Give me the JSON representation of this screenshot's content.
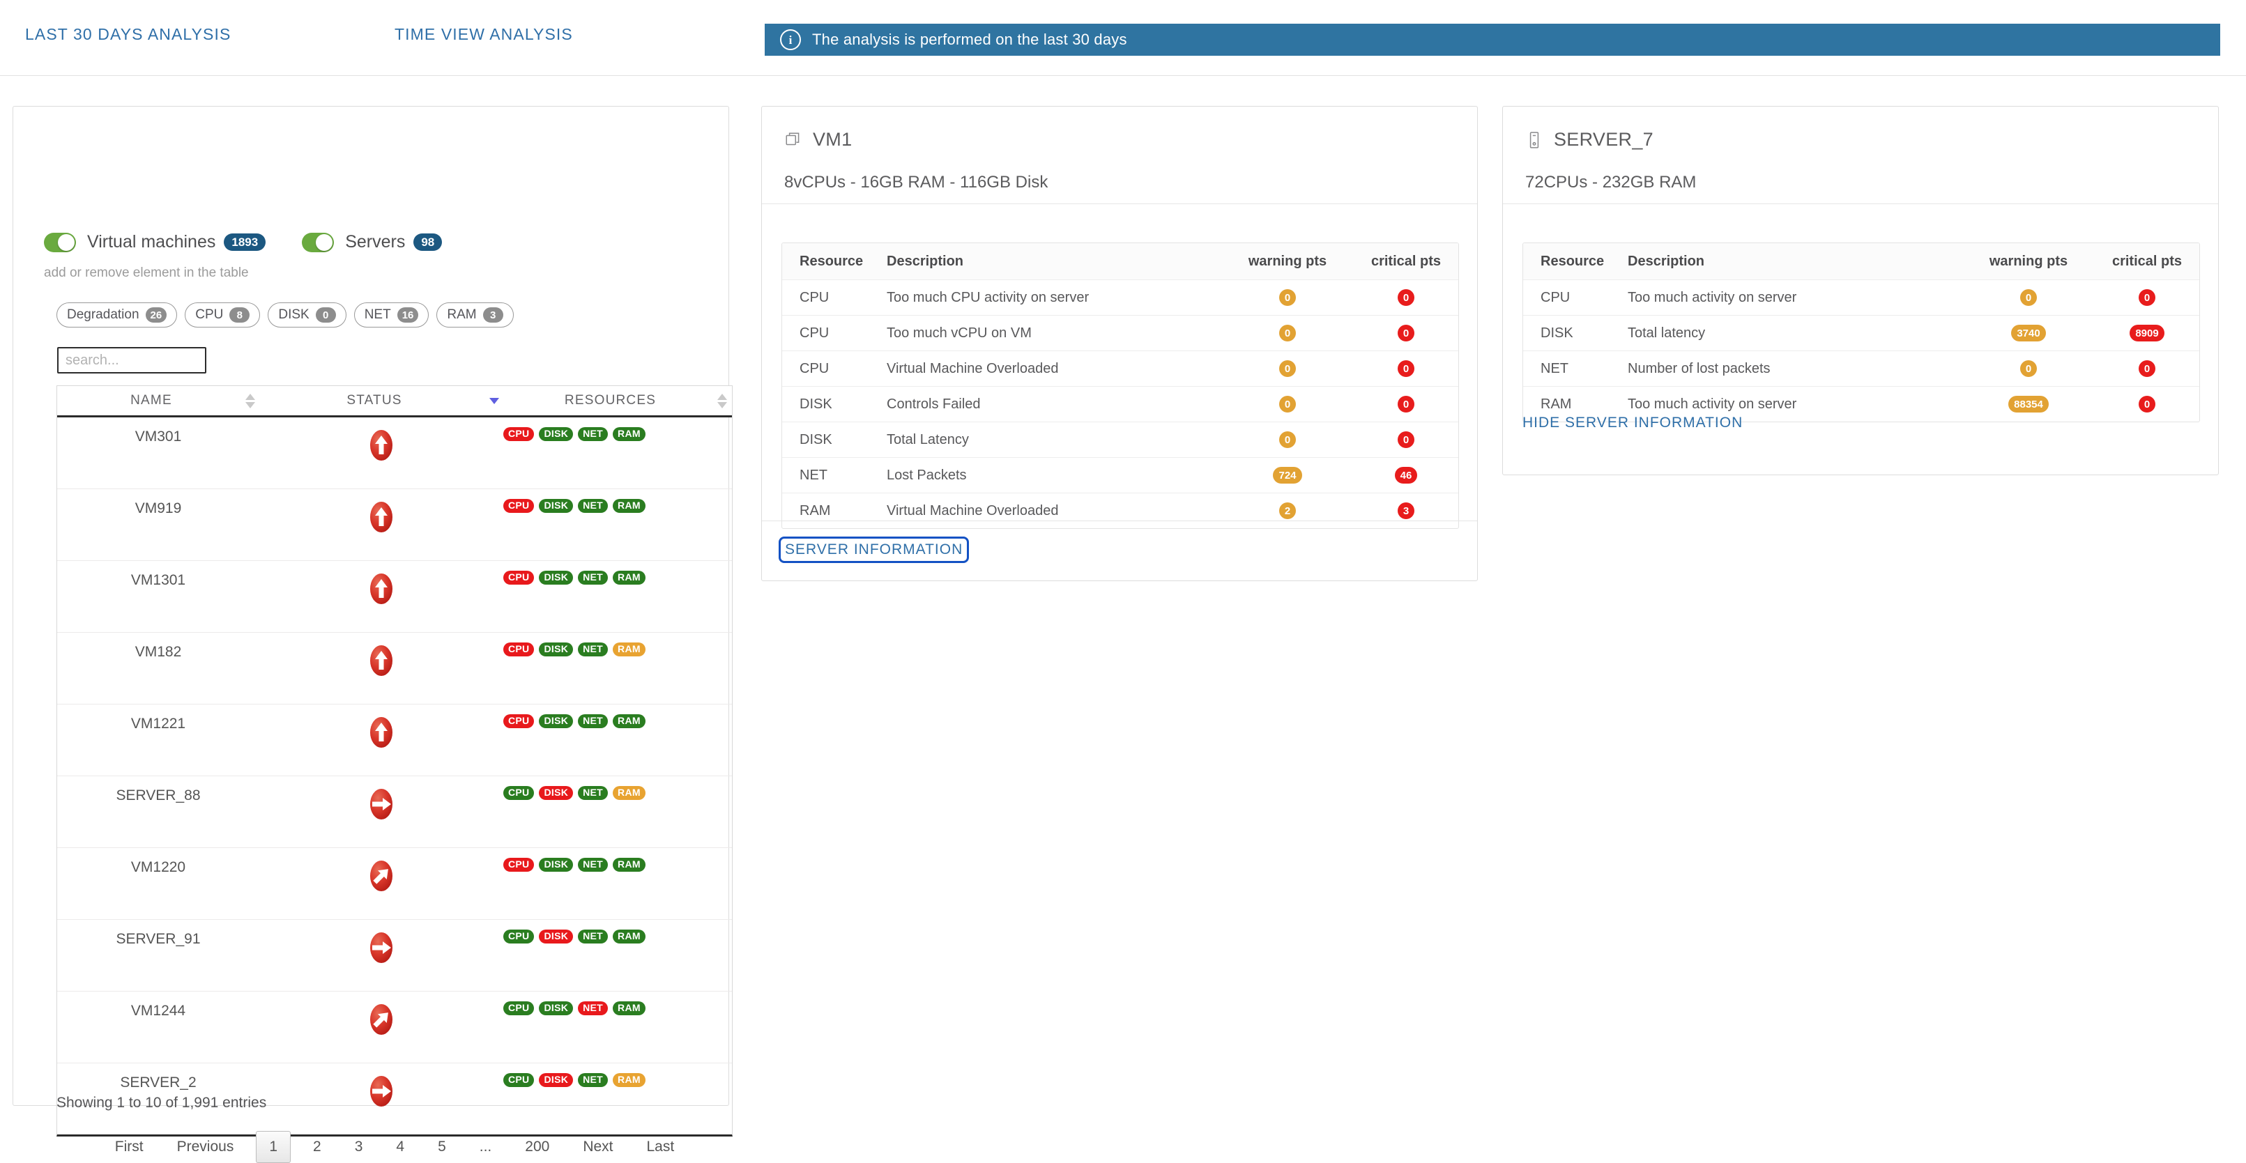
{
  "tabs": [
    {
      "label": "LAST 30 DAYS ANALYSIS"
    },
    {
      "label": "TIME VIEW ANALYSIS"
    }
  ],
  "alert": {
    "icon": "info-icon",
    "glyph": "i",
    "text": "The analysis is performed on the last 30 days",
    "color": "#2f74a1"
  },
  "filters": {
    "toggles": [
      {
        "label": "Virtual machines",
        "count": "1893",
        "on": true
      },
      {
        "label": "Servers",
        "count": "98",
        "on": true
      }
    ],
    "hint": "add or remove element in the table",
    "chips": [
      {
        "label": "Degradation",
        "count": "26"
      },
      {
        "label": "CPU",
        "count": "8"
      },
      {
        "label": "DISK",
        "count": "0"
      },
      {
        "label": "NET",
        "count": "16"
      },
      {
        "label": "RAM",
        "count": "3"
      }
    ],
    "search": {
      "value": "",
      "placeholder": "search..."
    }
  },
  "table": {
    "columns": [
      "NAME",
      "STATUS",
      "RESOURCES"
    ],
    "sorted_column": "STATUS",
    "sort_direction": "desc",
    "rows": [
      {
        "name": "VM301",
        "status": "up",
        "resources": [
          {
            "label": "CPU",
            "state": "red"
          },
          {
            "label": "DISK",
            "state": "green"
          },
          {
            "label": "NET",
            "state": "green"
          },
          {
            "label": "RAM",
            "state": "green"
          }
        ]
      },
      {
        "name": "VM919",
        "status": "up",
        "resources": [
          {
            "label": "CPU",
            "state": "red"
          },
          {
            "label": "DISK",
            "state": "green"
          },
          {
            "label": "NET",
            "state": "green"
          },
          {
            "label": "RAM",
            "state": "green"
          }
        ]
      },
      {
        "name": "VM1301",
        "status": "up",
        "resources": [
          {
            "label": "CPU",
            "state": "red"
          },
          {
            "label": "DISK",
            "state": "green"
          },
          {
            "label": "NET",
            "state": "green"
          },
          {
            "label": "RAM",
            "state": "green"
          }
        ]
      },
      {
        "name": "VM182",
        "status": "up",
        "resources": [
          {
            "label": "CPU",
            "state": "red"
          },
          {
            "label": "DISK",
            "state": "green"
          },
          {
            "label": "NET",
            "state": "green"
          },
          {
            "label": "RAM",
            "state": "orange"
          }
        ]
      },
      {
        "name": "VM1221",
        "status": "up",
        "resources": [
          {
            "label": "CPU",
            "state": "red"
          },
          {
            "label": "DISK",
            "state": "green"
          },
          {
            "label": "NET",
            "state": "green"
          },
          {
            "label": "RAM",
            "state": "green"
          }
        ]
      },
      {
        "name": "SERVER_88",
        "status": "right",
        "resources": [
          {
            "label": "CPU",
            "state": "green"
          },
          {
            "label": "DISK",
            "state": "red"
          },
          {
            "label": "NET",
            "state": "green"
          },
          {
            "label": "RAM",
            "state": "orange"
          }
        ]
      },
      {
        "name": "VM1220",
        "status": "up-right",
        "resources": [
          {
            "label": "CPU",
            "state": "red"
          },
          {
            "label": "DISK",
            "state": "green"
          },
          {
            "label": "NET",
            "state": "green"
          },
          {
            "label": "RAM",
            "state": "green"
          }
        ]
      },
      {
        "name": "SERVER_91",
        "status": "right",
        "resources": [
          {
            "label": "CPU",
            "state": "green"
          },
          {
            "label": "DISK",
            "state": "red"
          },
          {
            "label": "NET",
            "state": "green"
          },
          {
            "label": "RAM",
            "state": "green"
          }
        ]
      },
      {
        "name": "VM1244",
        "status": "up-right",
        "resources": [
          {
            "label": "CPU",
            "state": "green"
          },
          {
            "label": "DISK",
            "state": "green"
          },
          {
            "label": "NET",
            "state": "red"
          },
          {
            "label": "RAM",
            "state": "green"
          }
        ]
      },
      {
        "name": "SERVER_2",
        "status": "right",
        "resources": [
          {
            "label": "CPU",
            "state": "green"
          },
          {
            "label": "DISK",
            "state": "red"
          },
          {
            "label": "NET",
            "state": "green"
          },
          {
            "label": "RAM",
            "state": "orange"
          }
        ]
      }
    ],
    "showing": "Showing 1 to 10 of 1,991 entries",
    "pagination": {
      "first": "First",
      "previous": "Previous",
      "pages": [
        "1",
        "2",
        "3",
        "4",
        "5",
        "...",
        "200"
      ],
      "current": "1",
      "next": "Next",
      "last": "Last"
    }
  },
  "vm_detail": {
    "icon": "virtual-machine-icon",
    "title": "VM1",
    "spec": "8vCPUs - 16GB RAM - 116GB Disk",
    "columns": [
      "Resource",
      "Description",
      "warning pts",
      "critical pts"
    ],
    "rows": [
      {
        "resource": "CPU",
        "description": "Too much CPU activity on server",
        "warning": "0",
        "critical": "0"
      },
      {
        "resource": "CPU",
        "description": "Too much vCPU on VM",
        "warning": "0",
        "critical": "0"
      },
      {
        "resource": "CPU",
        "description": "Virtual Machine Overloaded",
        "warning": "0",
        "critical": "0"
      },
      {
        "resource": "DISK",
        "description": "Controls Failed",
        "warning": "0",
        "critical": "0"
      },
      {
        "resource": "DISK",
        "description": "Total Latency",
        "warning": "0",
        "critical": "0"
      },
      {
        "resource": "NET",
        "description": "Lost Packets",
        "warning": "724",
        "critical": "46"
      },
      {
        "resource": "RAM",
        "description": "Virtual Machine Overloaded",
        "warning": "2",
        "critical": "3"
      }
    ],
    "action_label": "SERVER INFORMATION"
  },
  "server_detail": {
    "icon": "server-icon",
    "title": "SERVER_7",
    "spec": "72CPUs - 232GB RAM",
    "columns": [
      "Resource",
      "Description",
      "warning pts",
      "critical pts"
    ],
    "rows": [
      {
        "resource": "CPU",
        "description": "Too much activity on server",
        "warning": "0",
        "critical": "0"
      },
      {
        "resource": "DISK",
        "description": "Total latency",
        "warning": "3740",
        "critical": "8909"
      },
      {
        "resource": "NET",
        "description": "Number of lost packets",
        "warning": "0",
        "critical": "0"
      },
      {
        "resource": "RAM",
        "description": "Too much activity on server",
        "warning": "88354",
        "critical": "0"
      }
    ],
    "action_label": "HIDE SERVER INFORMATION"
  },
  "colors": {
    "accent_blue": "#2f6fa8",
    "banner_blue": "#2f74a1",
    "badge_blue": "#1c5881",
    "green": "#2a7d20",
    "red": "#e8191c",
    "orange": "#e8a331",
    "toggle_green": "#6aaa3f"
  }
}
